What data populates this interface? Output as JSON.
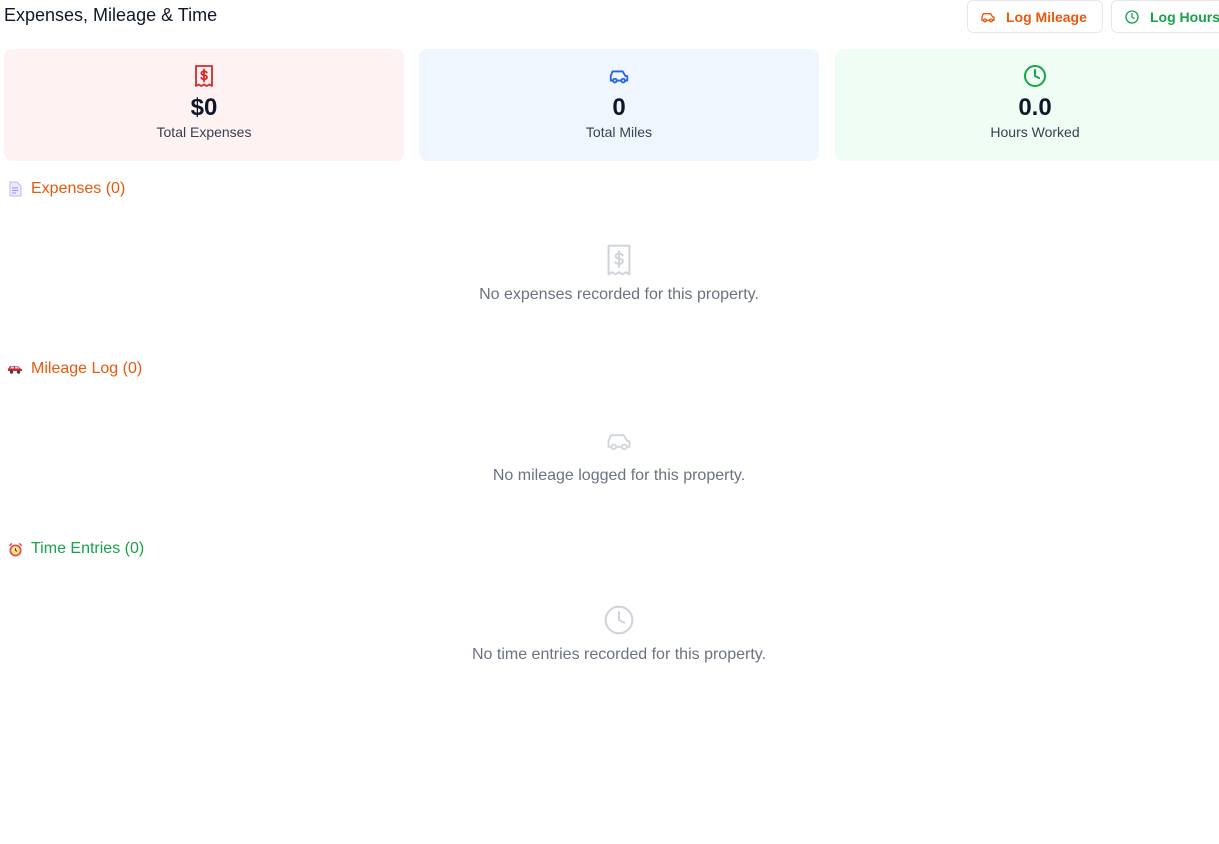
{
  "header": {
    "title": "Expenses, Mileage & Time",
    "log_mileage_label": "Log Mileage",
    "log_hours_label": "Log Hours"
  },
  "summary": {
    "expenses": {
      "value": "$0",
      "label": "Total Expenses",
      "icon": "receipt-icon",
      "color": "#dc2626"
    },
    "miles": {
      "value": "0",
      "label": "Total Miles",
      "icon": "car-icon",
      "color": "#2563eb"
    },
    "hours": {
      "value": "0.0",
      "label": "Hours Worked",
      "icon": "clock-icon",
      "color": "#16a34a"
    }
  },
  "sections": {
    "expenses": {
      "title": "Expenses (0)",
      "icon": "page-emoji-icon",
      "empty_text": "No expenses recorded for this property."
    },
    "mileage": {
      "title": "Mileage Log (0)",
      "icon": "car-emoji-icon",
      "empty_text": "No mileage logged for this property."
    },
    "time": {
      "title": "Time Entries (0)",
      "icon": "alarm-clock-emoji-icon",
      "empty_text": "No time entries recorded for this property."
    }
  },
  "colors": {
    "accent_orange": "#ea580c",
    "accent_green": "#16a34a",
    "muted_text": "#6b7280"
  }
}
